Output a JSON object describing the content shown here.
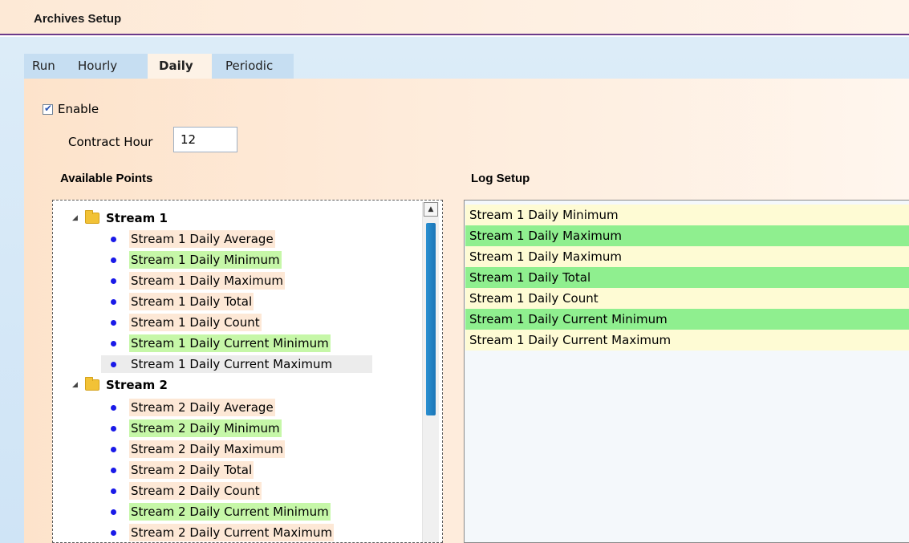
{
  "window": {
    "title": "Archives Setup"
  },
  "tabs": [
    {
      "label": "Run",
      "active": false
    },
    {
      "label": "Hourly",
      "active": false
    },
    {
      "label": "Daily",
      "active": true
    },
    {
      "label": "Periodic",
      "active": false
    }
  ],
  "form": {
    "enable_label": "Enable",
    "enable_checked": true,
    "contract_hour_label": "Contract Hour",
    "contract_hour_value": "12"
  },
  "available_points": {
    "title": "Available Points",
    "groups": [
      {
        "label": "Stream 1",
        "expanded": true,
        "items": [
          "Stream 1 Daily Average",
          "Stream 1 Daily Minimum",
          "Stream 1 Daily Maximum",
          "Stream 1 Daily Total",
          "Stream 1 Daily Count",
          "Stream 1 Daily Current Minimum",
          "Stream 1 Daily Current Maximum"
        ]
      },
      {
        "label": "Stream 2",
        "expanded": true,
        "items": [
          "Stream 2 Daily Average",
          "Stream 2 Daily Minimum",
          "Stream 2 Daily Maximum",
          "Stream 2 Daily Total",
          "Stream 2 Daily Count",
          "Stream 2 Daily Current Minimum",
          "Stream 2 Daily Current Maximum"
        ]
      }
    ]
  },
  "log_setup": {
    "title": "Log Setup",
    "rows": [
      "Stream 1 Daily Minimum",
      "Stream 1 Daily Maximum",
      "Stream 1 Daily Maximum",
      "Stream 1 Daily Total",
      "Stream 1 Daily Count",
      "Stream 1 Daily Current Minimum",
      "Stream 1 Daily Current Maximum"
    ]
  },
  "colors": {
    "header_border": "#6b3a8a",
    "bullet": "#1a1ae8",
    "highlight_green": "#c6f7a8",
    "highlight_peach": "#fde8d6",
    "log_green": "#8fef8f",
    "log_yellow": "#fefbd4",
    "scroll_thumb": "#2a8fd0"
  }
}
